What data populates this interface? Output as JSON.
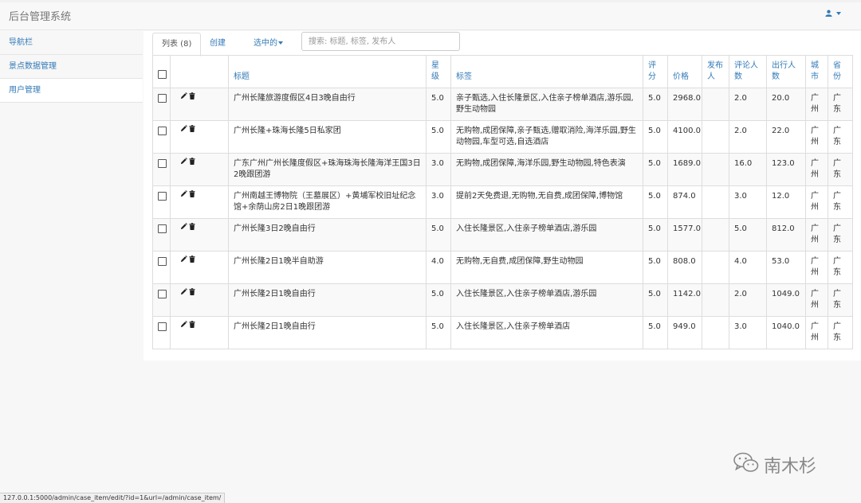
{
  "app": {
    "title": "后台管理系统"
  },
  "sidebar": {
    "items": [
      {
        "label": "导航栏"
      },
      {
        "label": "景点数据管理"
      },
      {
        "label": "用户管理"
      }
    ]
  },
  "tabs": {
    "list": "列表 (8)",
    "create": "创建",
    "selected": "选中的"
  },
  "search": {
    "placeholder": "搜索: 标题, 标签, 发布人"
  },
  "table": {
    "headers": [
      "",
      "",
      "标题",
      "星级",
      "标签",
      "评分",
      "价格",
      "发布人",
      "评论人数",
      "出行人数",
      "城市",
      "省份"
    ],
    "rows": [
      {
        "title": "广州长隆旅游度假区4日3晚自由行",
        "star": "5.0",
        "tags": "亲子甄选,入住长隆景区,入住亲子榜单酒店,游乐园,野生动物园",
        "score": "5.0",
        "price": "2968.0",
        "publisher": "",
        "comments": "2.0",
        "travelers": "20.0",
        "city": "广州",
        "province": "广东"
      },
      {
        "title": "广州长隆+珠海长隆5日私家团",
        "star": "5.0",
        "tags": "无购物,成团保障,亲子甄选,赠取消险,海洋乐园,野生动物园,车型可选,自选酒店",
        "score": "5.0",
        "price": "4100.0",
        "publisher": "",
        "comments": "2.0",
        "travelers": "22.0",
        "city": "广州",
        "province": "广东"
      },
      {
        "title": "广东广州广州长隆度假区+珠海珠海长隆海洋王国3日2晚跟团游",
        "star": "3.0",
        "tags": "无购物,成团保障,海洋乐园,野生动物园,特色表演",
        "score": "5.0",
        "price": "1689.0",
        "publisher": "",
        "comments": "16.0",
        "travelers": "123.0",
        "city": "广州",
        "province": "广东"
      },
      {
        "title": "广州南越王博物院（王墓展区）+黄埔军校旧址纪念馆+余荫山房2日1晚跟团游",
        "star": "3.0",
        "tags": "提前2天免费退,无购物,无自费,成团保障,博物馆",
        "score": "5.0",
        "price": "874.0",
        "publisher": "",
        "comments": "3.0",
        "travelers": "12.0",
        "city": "广州",
        "province": "广东"
      },
      {
        "title": "广州长隆3日2晚自由行",
        "star": "5.0",
        "tags": "入住长隆景区,入住亲子榜单酒店,游乐园",
        "score": "5.0",
        "price": "1577.0",
        "publisher": "",
        "comments": "5.0",
        "travelers": "812.0",
        "city": "广州",
        "province": "广东"
      },
      {
        "title": "广州长隆2日1晚半自助游",
        "star": "4.0",
        "tags": "无购物,无自费,成团保障,野生动物园",
        "score": "5.0",
        "price": "808.0",
        "publisher": "",
        "comments": "4.0",
        "travelers": "53.0",
        "city": "广州",
        "province": "广东"
      },
      {
        "title": "广州长隆2日1晚自由行",
        "star": "5.0",
        "tags": "入住长隆景区,入住亲子榜单酒店,游乐园",
        "score": "5.0",
        "price": "1142.0",
        "publisher": "",
        "comments": "2.0",
        "travelers": "1049.0",
        "city": "广州",
        "province": "广东"
      },
      {
        "title": "广州长隆2日1晚自由行",
        "star": "5.0",
        "tags": "入住长隆景区,入住亲子榜单酒店",
        "score": "5.0",
        "price": "949.0",
        "publisher": "",
        "comments": "3.0",
        "travelers": "1040.0",
        "city": "广州",
        "province": "广东"
      }
    ]
  },
  "statusbar": {
    "url": "127.0.0.1:5000/admin/case_item/edit/?id=1&url=/admin/case_item/"
  },
  "watermark": {
    "text": "南木杉"
  },
  "icons": {
    "user": "user-icon",
    "edit": "pencil-icon",
    "delete": "trash-icon",
    "watermark": "wechat-icon"
  },
  "colors": {
    "link": "#337ab7",
    "border": "#dddddd",
    "stripe": "#f9f9f9"
  }
}
